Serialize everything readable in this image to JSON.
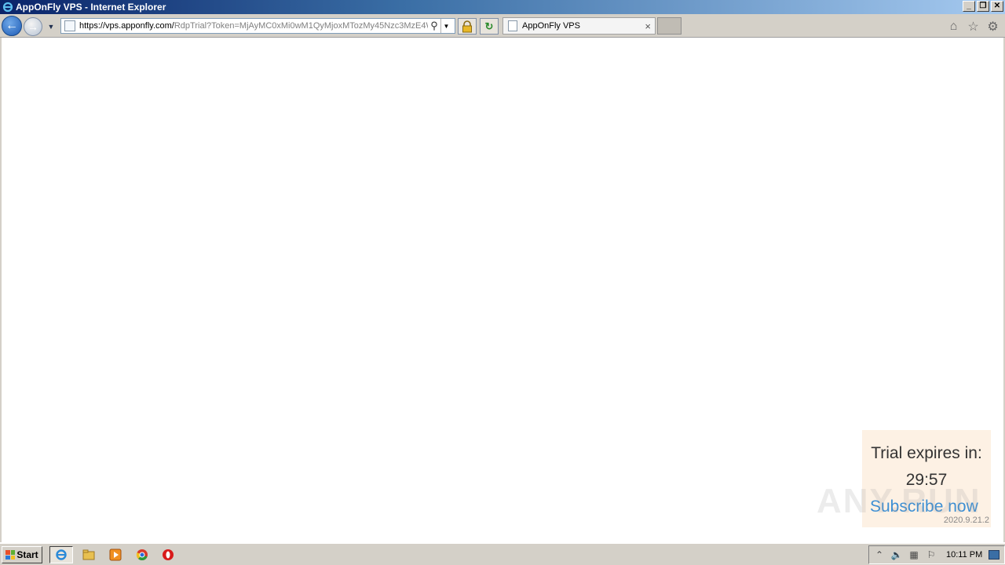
{
  "window": {
    "title": "AppOnFly VPS - Internet Explorer",
    "min_label": "_",
    "restore_label": "❐",
    "close_label": "✕"
  },
  "navbar": {
    "back_glyph": "←",
    "forward_glyph": "→",
    "dropdown_glyph": "▼",
    "url_host": "https://vps.apponfly.com/",
    "url_path": "RdpTrial?Token=MjAyMC0xMi0wM1QyMjoxMTozMy45Nzc3MzE4Wi",
    "search_glyph": "⚲",
    "url_dropdown_glyph": "▼",
    "refresh_glyph": "↻"
  },
  "tabs": [
    {
      "label": "AppOnFly VPS",
      "close_glyph": "×"
    }
  ],
  "toolbar": {
    "home_glyph": "⌂",
    "favorites_glyph": "☆",
    "tools_glyph": "⚙"
  },
  "trial": {
    "label": "Trial expires in:",
    "time": "29:57",
    "link": "Subscribe now",
    "version": "2020.9.21.2"
  },
  "watermark": "ANY.RUN",
  "taskbar": {
    "start_label": "Start",
    "clock": "10:11 PM"
  },
  "colors": {
    "accent_link": "#3d8fd4",
    "trial_bg": "#fdf1e4",
    "chrome": "#d4d0c8"
  }
}
